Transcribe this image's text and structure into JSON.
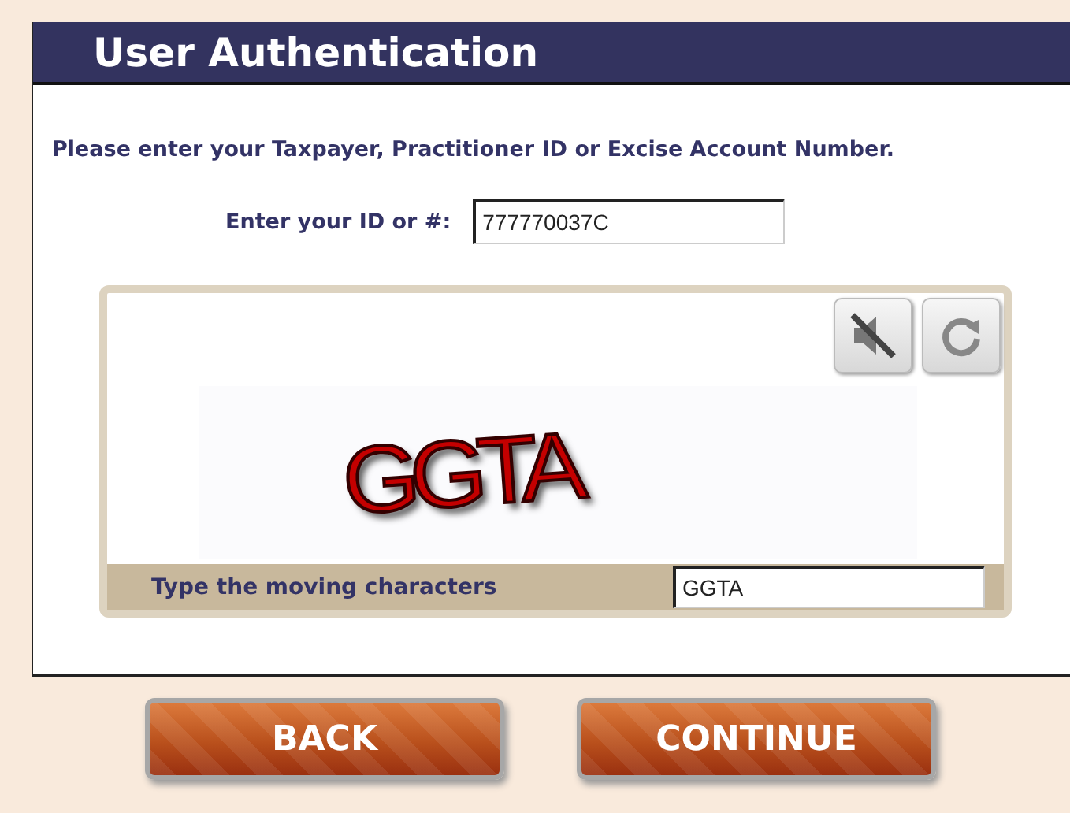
{
  "header": {
    "title": "User Authentication"
  },
  "instructions": "Please enter your Taxpayer, Practitioner ID or Excise Account Number.",
  "id_field": {
    "label": "Enter your ID or #:",
    "value": "777770037C"
  },
  "captcha": {
    "text": "GGTA",
    "audio_muted": true,
    "prompt": "Type the moving characters",
    "answer": "GGTA"
  },
  "buttons": [
    "BACK",
    "CONTINUE"
  ]
}
